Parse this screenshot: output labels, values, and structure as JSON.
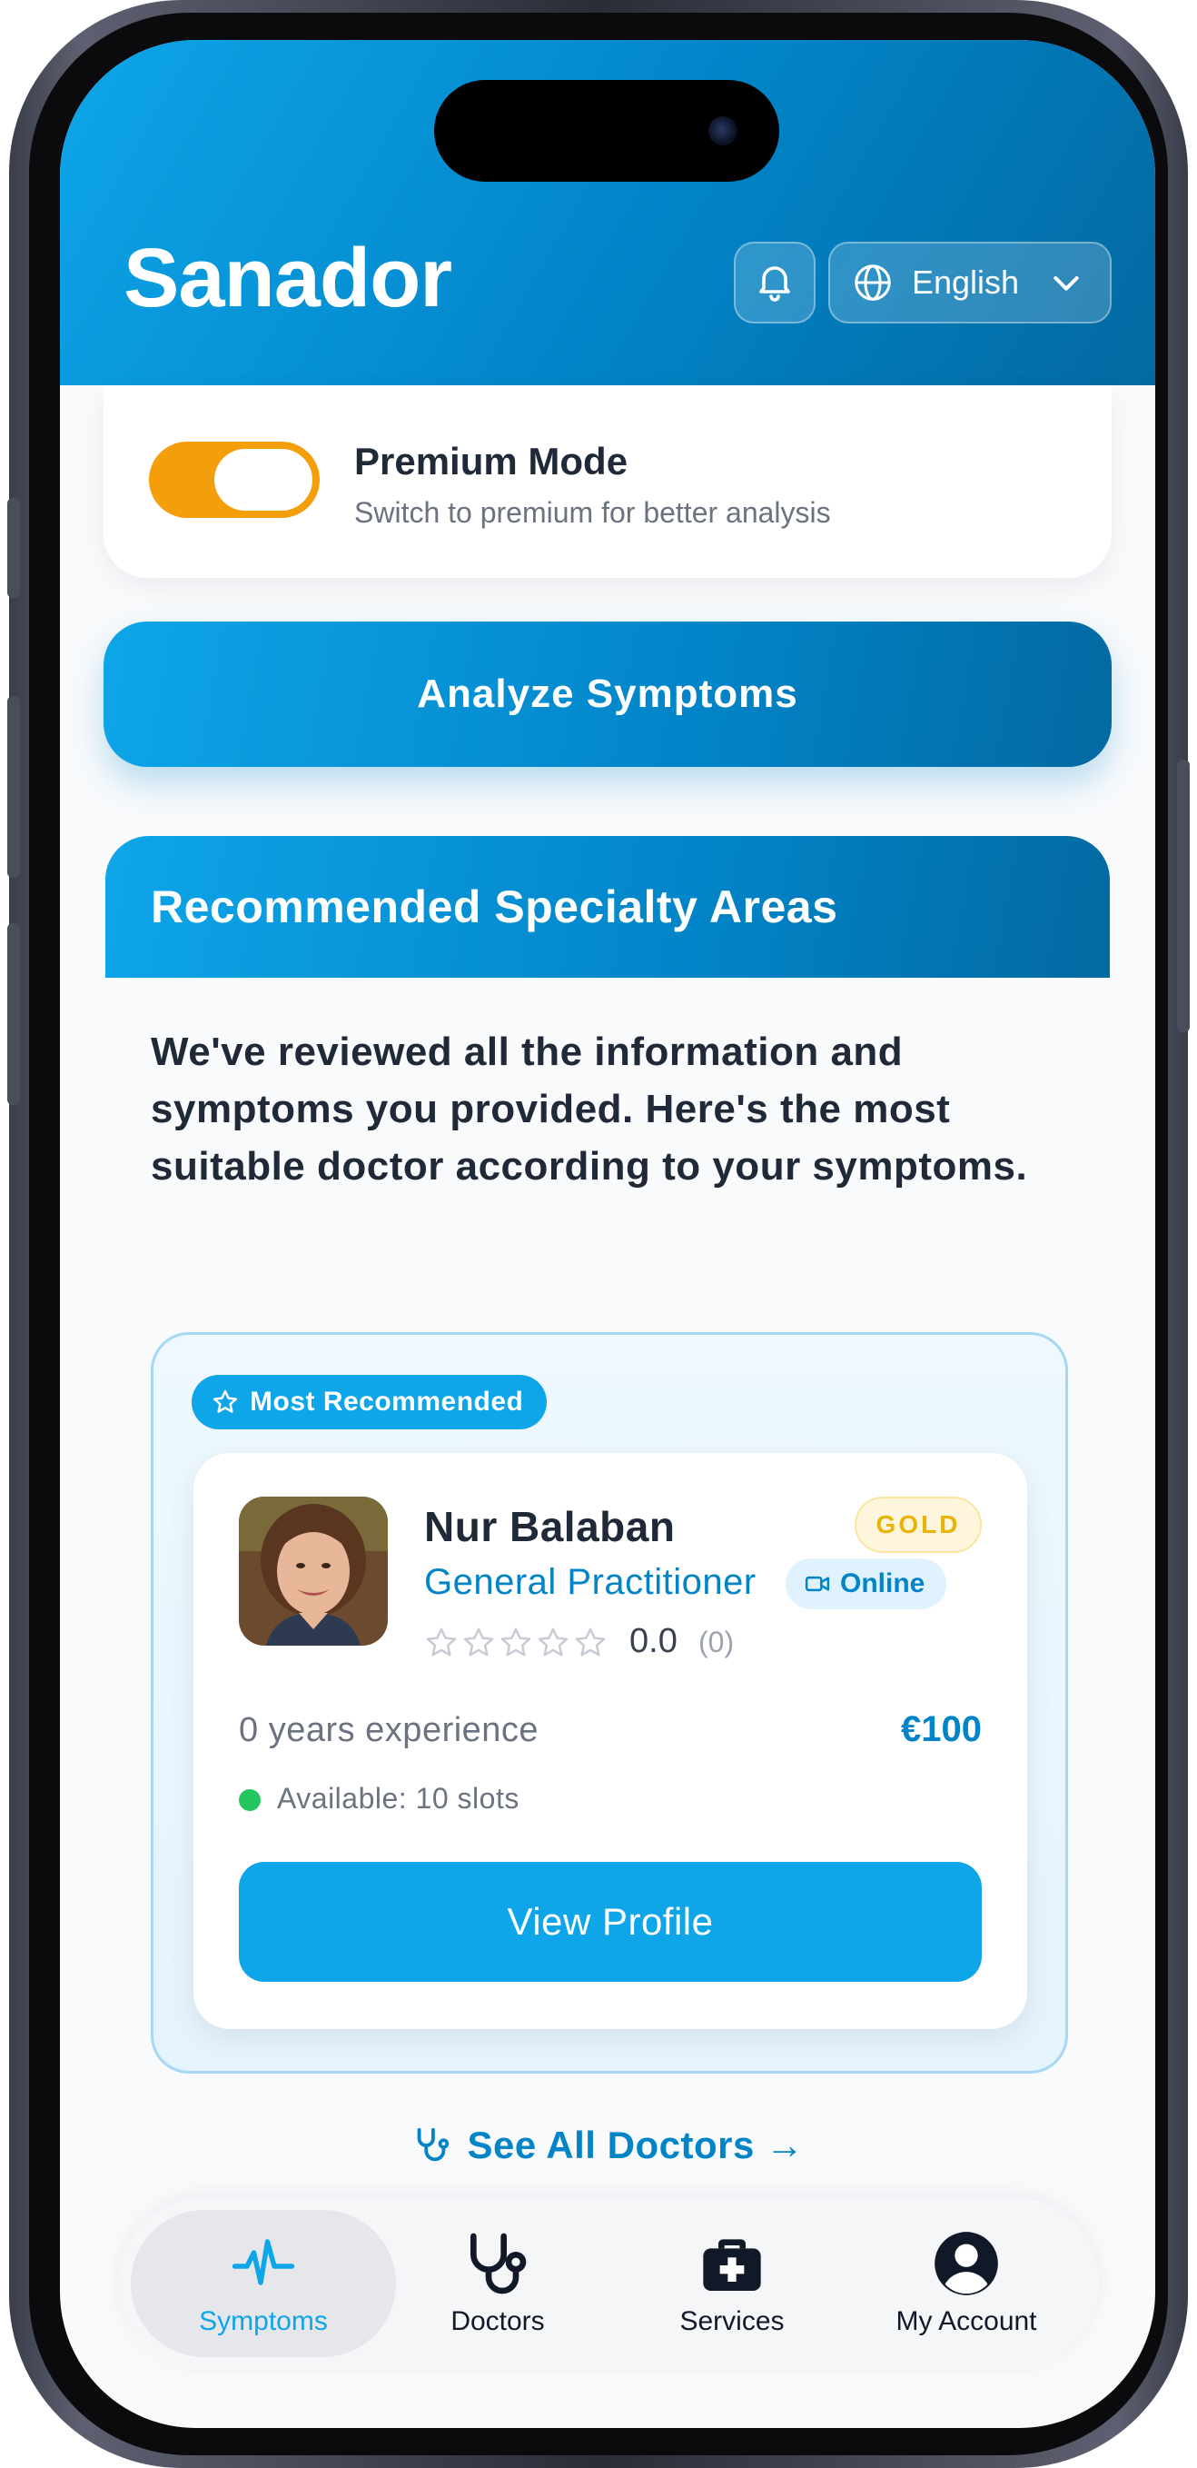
{
  "header": {
    "app_title": "Sanador",
    "language": "English"
  },
  "premium": {
    "enabled": true,
    "title": "Premium Mode",
    "subtitle": "Switch to premium for better analysis"
  },
  "actions": {
    "analyze_label": "Analyze Symptoms"
  },
  "specialty": {
    "title": "Recommended Specialty Areas",
    "description": "We've reviewed all the information and symptoms you provided. Here's the most suitable doctor according to your symptoms.",
    "badge": "Most Recommended",
    "doctor": {
      "name": "Nur Balaban",
      "tier": "GOLD",
      "specialty": "General Practitioner",
      "mode": "Online",
      "rating": "0.0",
      "rating_count": "(0)",
      "stars_filled": 0,
      "experience": "0 years experience",
      "price": "€100",
      "availability": "Available: 10 slots",
      "view_label": "View Profile"
    },
    "see_all_label": "See All Doctors →"
  },
  "nav": {
    "items": [
      {
        "label": "Symptoms",
        "icon": "heartbeat-icon",
        "active": true
      },
      {
        "label": "Doctors",
        "icon": "stethoscope-icon",
        "active": false
      },
      {
        "label": "Services",
        "icon": "medical-kit-icon",
        "active": false
      },
      {
        "label": "My Account",
        "icon": "user-circle-icon",
        "active": false
      }
    ]
  },
  "colors": {
    "primary": "#0ea5e9",
    "primary_dark": "#0369a1",
    "toggle_on": "#f59e0b",
    "gold": "#eab308",
    "available": "#22c55e"
  }
}
